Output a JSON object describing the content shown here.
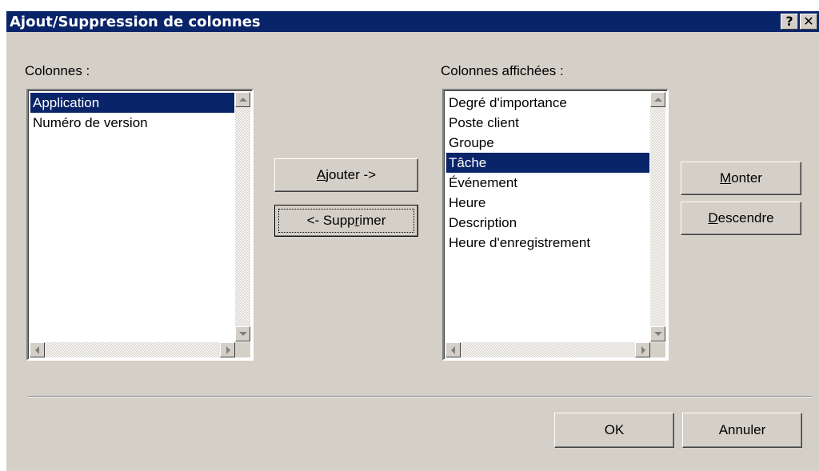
{
  "dialog": {
    "title": "Ajout/Suppression de colonnes",
    "help_button": "?",
    "close_button": "✕"
  },
  "available": {
    "label": "Colonnes :",
    "items": [
      "Application",
      "Numéro de version"
    ],
    "selected_index": 0
  },
  "displayed": {
    "label": "Colonnes affichées :",
    "items": [
      "Degré d'importance",
      "Poste client",
      "Groupe",
      "Tâche",
      "Événement",
      "Heure",
      "Description",
      "Heure d'enregistrement"
    ],
    "selected_index": 3
  },
  "buttons": {
    "add": {
      "pre": "",
      "mn": "A",
      "post": "jouter ->"
    },
    "remove": {
      "pre": "<- Supp",
      "mn": "r",
      "post": "imer"
    },
    "up": {
      "pre": "",
      "mn": "M",
      "post": "onter"
    },
    "down": {
      "pre": "",
      "mn": "D",
      "post": "escendre"
    },
    "ok": "OK",
    "cancel": "Annuler"
  },
  "colors": {
    "titlebar": "#0a246a",
    "selection": "#0a246a",
    "face": "#d4d0c8"
  }
}
